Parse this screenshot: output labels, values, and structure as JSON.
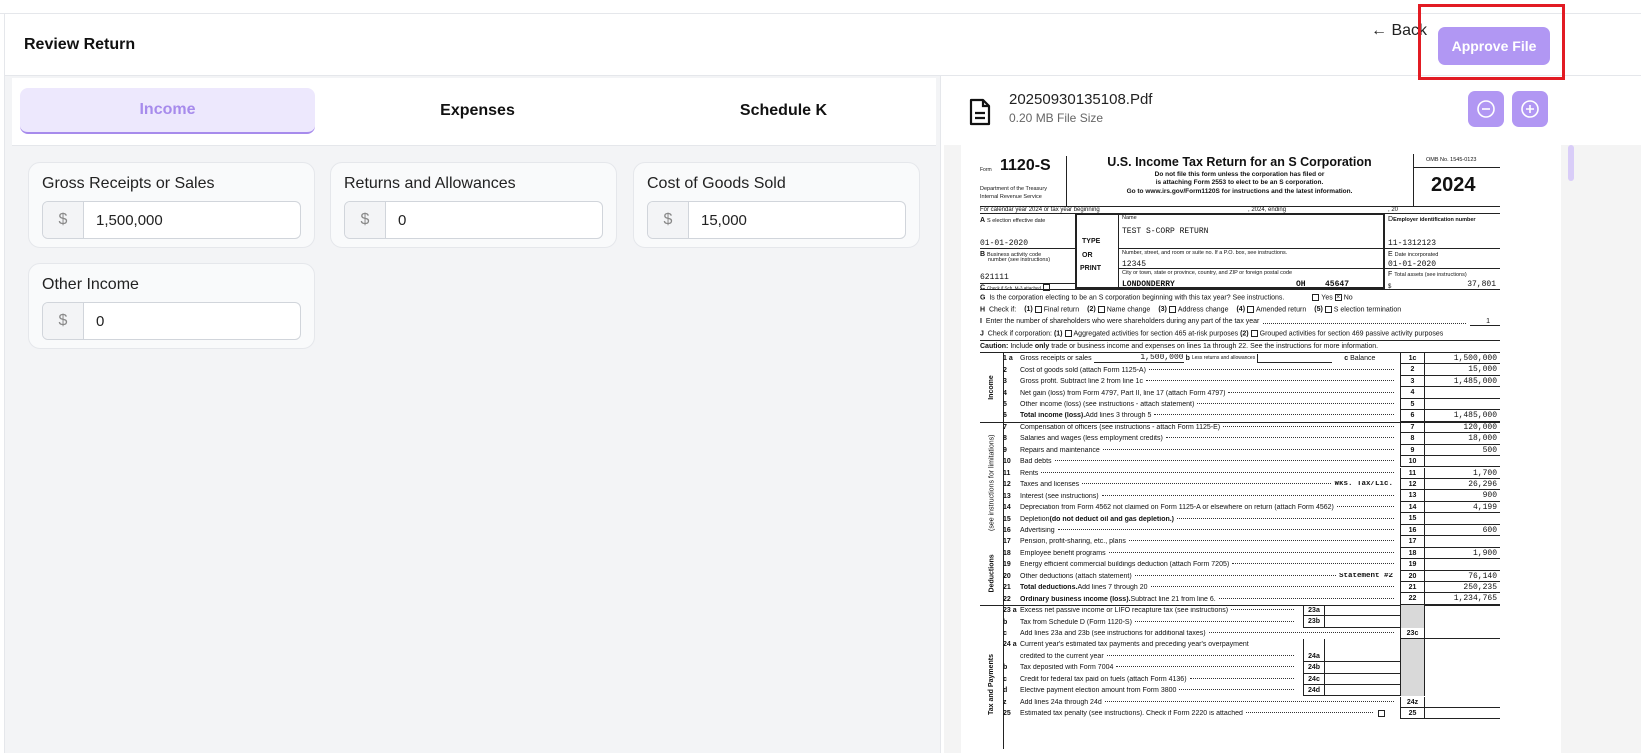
{
  "header": {
    "title": "Review Return",
    "back_label": "← Back",
    "approve_label": "Approve File"
  },
  "tabs": [
    {
      "label": "Income",
      "active": true
    },
    {
      "label": "Expenses"
    },
    {
      "label": "Schedule K"
    }
  ],
  "income_fields": [
    {
      "label": "Gross Receipts or Sales",
      "currency": "$",
      "value": "1,500,000"
    },
    {
      "label": "Returns and Allowances",
      "currency": "$",
      "value": "0"
    },
    {
      "label": "Cost of Goods Sold",
      "currency": "$",
      "value": "15,000"
    },
    {
      "label": "Other Income",
      "currency": "$",
      "value": "0"
    }
  ],
  "file": {
    "name": "20250930135108.Pdf",
    "size": "0.20 MB File Size",
    "icons": [
      "file-icon",
      "zoom-out-icon",
      "zoom-in-icon"
    ]
  },
  "colors": {
    "accent": "#b197f3",
    "tab_active_bg": "#ede8fd",
    "highlight": "#e21b23"
  },
  "form": {
    "form_word": "Form",
    "form_number": "1120-S",
    "dept1": "Department of the Treasury",
    "dept2": "Internal Revenue Service",
    "title": "U.S. Income Tax Return for an S Corporation",
    "sub1": "Do not file this form unless the corporation has filed or",
    "sub2": "is attaching Form 2553 to elect to be an S corporation.",
    "sub3": "Go to www.irs.gov/Form1120S for instructions and the latest information.",
    "omb": "OMB No. 1545-0123",
    "year": "2024",
    "calendar": "For calendar year 2024 or tax year beginning",
    "ending": ", 2024, ending",
    "twenty": ", 20",
    "a_label": "S election effective date",
    "a_letter": "A",
    "a_value": "01-01-2020",
    "b_letter": "B",
    "b_label1": "Business activity code",
    "b_label2": "number (see instructions)",
    "b_value": "621111",
    "c_letter": "C",
    "c_label": "Check if Sch. M-3 attached",
    "type1": "TYPE",
    "type2": "OR",
    "type3": "PRINT",
    "name_label": "Name",
    "name_value": "TEST S-CORP RETURN",
    "street_label": "Number, street, and room or suite no. If a P.O. box, see instructions.",
    "street_value": "12345",
    "city_label": "City or town, state or province, country, and ZIP or foreign postal code",
    "city_value": "LONDONDERRY",
    "state_value": "OH",
    "zip_value": "45647",
    "d_letter": "D",
    "d_label": "Employer identification number",
    "d_value": "11-1312123",
    "e_letter": "E",
    "e_label": "Date incorporated",
    "e_value": "01-01-2020",
    "f_letter": "F",
    "f_label": "Total assets (see instructions)",
    "f_dollar": "$",
    "f_value": "37,801",
    "g_letter": "G",
    "g_text": "Is the corporation electing to be an S corporation beginning with this tax year? See instructions.",
    "g_yes": "Yes",
    "g_no": "No",
    "g_no_checked": true,
    "h_letter": "H",
    "h_text": "Check if:",
    "h_items": [
      "(1)",
      "Final return",
      "(2)",
      "Name change",
      "(3)",
      "Address change",
      "(4)",
      "Amended return",
      "(5)",
      "S election termination"
    ],
    "i_letter": "I",
    "i_text": "Enter the number of shareholders who were shareholders during any part of the tax year",
    "i_value": "1",
    "j_letter": "J",
    "j_text": "Check if corporation:",
    "j_1": "(1)",
    "j_1_text": "Aggregated activities for section 465 at-risk purposes",
    "j_2": "(2)",
    "j_2_text": "Grouped activities for section 469 passive activity purposes",
    "caution_label": "Caution:",
    "caution_pre": "Include",
    "caution_only": "only",
    "caution_post": "trade or business income and expenses on lines 1a through 22.  See the instructions for more information.",
    "section_income": "Income",
    "section_deductions": "Deductions",
    "section_deductions_note": "(see instructions for limitations)",
    "section_tax": "Tax and Payments",
    "line1": {
      "num": "1 a",
      "label": "Gross receipts or sales",
      "value": "1,500,000",
      "b_label": "b",
      "b_text": "Less returns and allowances",
      "b_value": "",
      "c_label": "c",
      "c_text": "Balance",
      "ref": "1c",
      "amount": "1,500,000"
    },
    "lines": [
      {
        "num": "2",
        "label": "Cost of goods sold (attach Form 1125-A)",
        "ref": "2",
        "amount": "15,000"
      },
      {
        "num": "3",
        "label": "Gross profit. Subtract line 2 from line 1c",
        "ref": "3",
        "amount": "1,485,000"
      },
      {
        "num": "4",
        "label": "Net gain (loss) from Form 4797, Part II, line 17 (attach Form 4797)",
        "ref": "4",
        "amount": ""
      },
      {
        "num": "5",
        "label": "Other income (loss) (see instructions - attach statement)",
        "ref": "5",
        "amount": ""
      },
      {
        "num": "6",
        "bold": "Total income (loss).",
        "label": " Add lines 3 through 5",
        "ref": "6",
        "amount": "1,485,000"
      },
      {
        "num": "7",
        "label": "Compensation of officers (see instructions - attach Form 1125-E)",
        "ref": "7",
        "amount": "120,000"
      },
      {
        "num": "8",
        "label": "Salaries and wages (less employment credits)",
        "ref": "8",
        "amount": "18,000"
      },
      {
        "num": "9",
        "label": "Repairs and maintenance",
        "ref": "9",
        "amount": "500"
      },
      {
        "num": "10",
        "label": "Bad debts",
        "ref": "10",
        "amount": ""
      },
      {
        "num": "11",
        "label": "Rents",
        "ref": "11",
        "amount": "1,700"
      },
      {
        "num": "12",
        "label": "Taxes and licenses",
        "note": "Wks. Tax/Lic.",
        "ref": "12",
        "amount": "26,296"
      },
      {
        "num": "13",
        "label": "Interest (see instructions)",
        "ref": "13",
        "amount": "900"
      },
      {
        "num": "14",
        "label": "Depreciation from Form 4562 not claimed on Form 1125-A or elsewhere on return (attach Form 4562)",
        "ref": "14",
        "amount": "4,199"
      },
      {
        "num": "15",
        "label": "Depletion ",
        "bold2": "(do not deduct oil and gas depletion.)",
        "ref": "15",
        "amount": ""
      },
      {
        "num": "16",
        "label": "Advertising",
        "ref": "16",
        "amount": "600"
      },
      {
        "num": "17",
        "label": "Pension, profit-sharing, etc., plans",
        "ref": "17",
        "amount": ""
      },
      {
        "num": "18",
        "label": "Employee benefit programs",
        "ref": "18",
        "amount": "1,900"
      },
      {
        "num": "19",
        "label": "Energy efficient commercial buildings deduction (attach Form 7205)",
        "ref": "19",
        "amount": ""
      },
      {
        "num": "20",
        "label": "Other deductions (attach statement)",
        "note": "Statement #2",
        "ref": "20",
        "amount": "76,140"
      },
      {
        "num": "21",
        "bold": "Total deductions.",
        "label": " Add lines 7 through 20",
        "ref": "21",
        "amount": "250,235"
      },
      {
        "num": "22",
        "bold": "Ordinary business income (loss).",
        "label": " Subtract line 21 from line 6.",
        "ref": "22",
        "amount": "1,234,765"
      },
      {
        "num": "23 a",
        "label": "Excess net passive income or LIFO recapture tax (see instructions)",
        "inner": "23a",
        "grey": true
      },
      {
        "num": "b",
        "label": "Tax from Schedule D (Form 1120-S)",
        "inner": "23b",
        "grey": true
      },
      {
        "num": "c",
        "label": "Add lines 23a and 23b (see instructions for additional taxes)",
        "ref": "23c",
        "amount": ""
      },
      {
        "num": "24 a",
        "label": "Current year's estimated tax payments and preceding year's overpayment",
        "nodots": true,
        "grey": true,
        "innerblank": true
      },
      {
        "num": "",
        "label": "credited to the current year",
        "inner": "24a",
        "grey": true
      },
      {
        "num": "b",
        "label": "Tax deposited with Form 7004",
        "inner": "24b",
        "grey": true
      },
      {
        "num": "c",
        "label": "Credit for federal tax paid on fuels (attach Form 4136)",
        "inner": "24c",
        "grey": true
      },
      {
        "num": "d",
        "label": "Elective payment election amount from Form 3800",
        "inner": "24d",
        "grey": true
      },
      {
        "num": "z",
        "label": "Add lines 24a through 24d",
        "ref": "24z",
        "amount": ""
      },
      {
        "num": "25",
        "label": "Estimated tax penalty (see instructions). Check if Form 2220 is attached",
        "checkbox": true,
        "ref": "25",
        "amount": ""
      }
    ]
  }
}
